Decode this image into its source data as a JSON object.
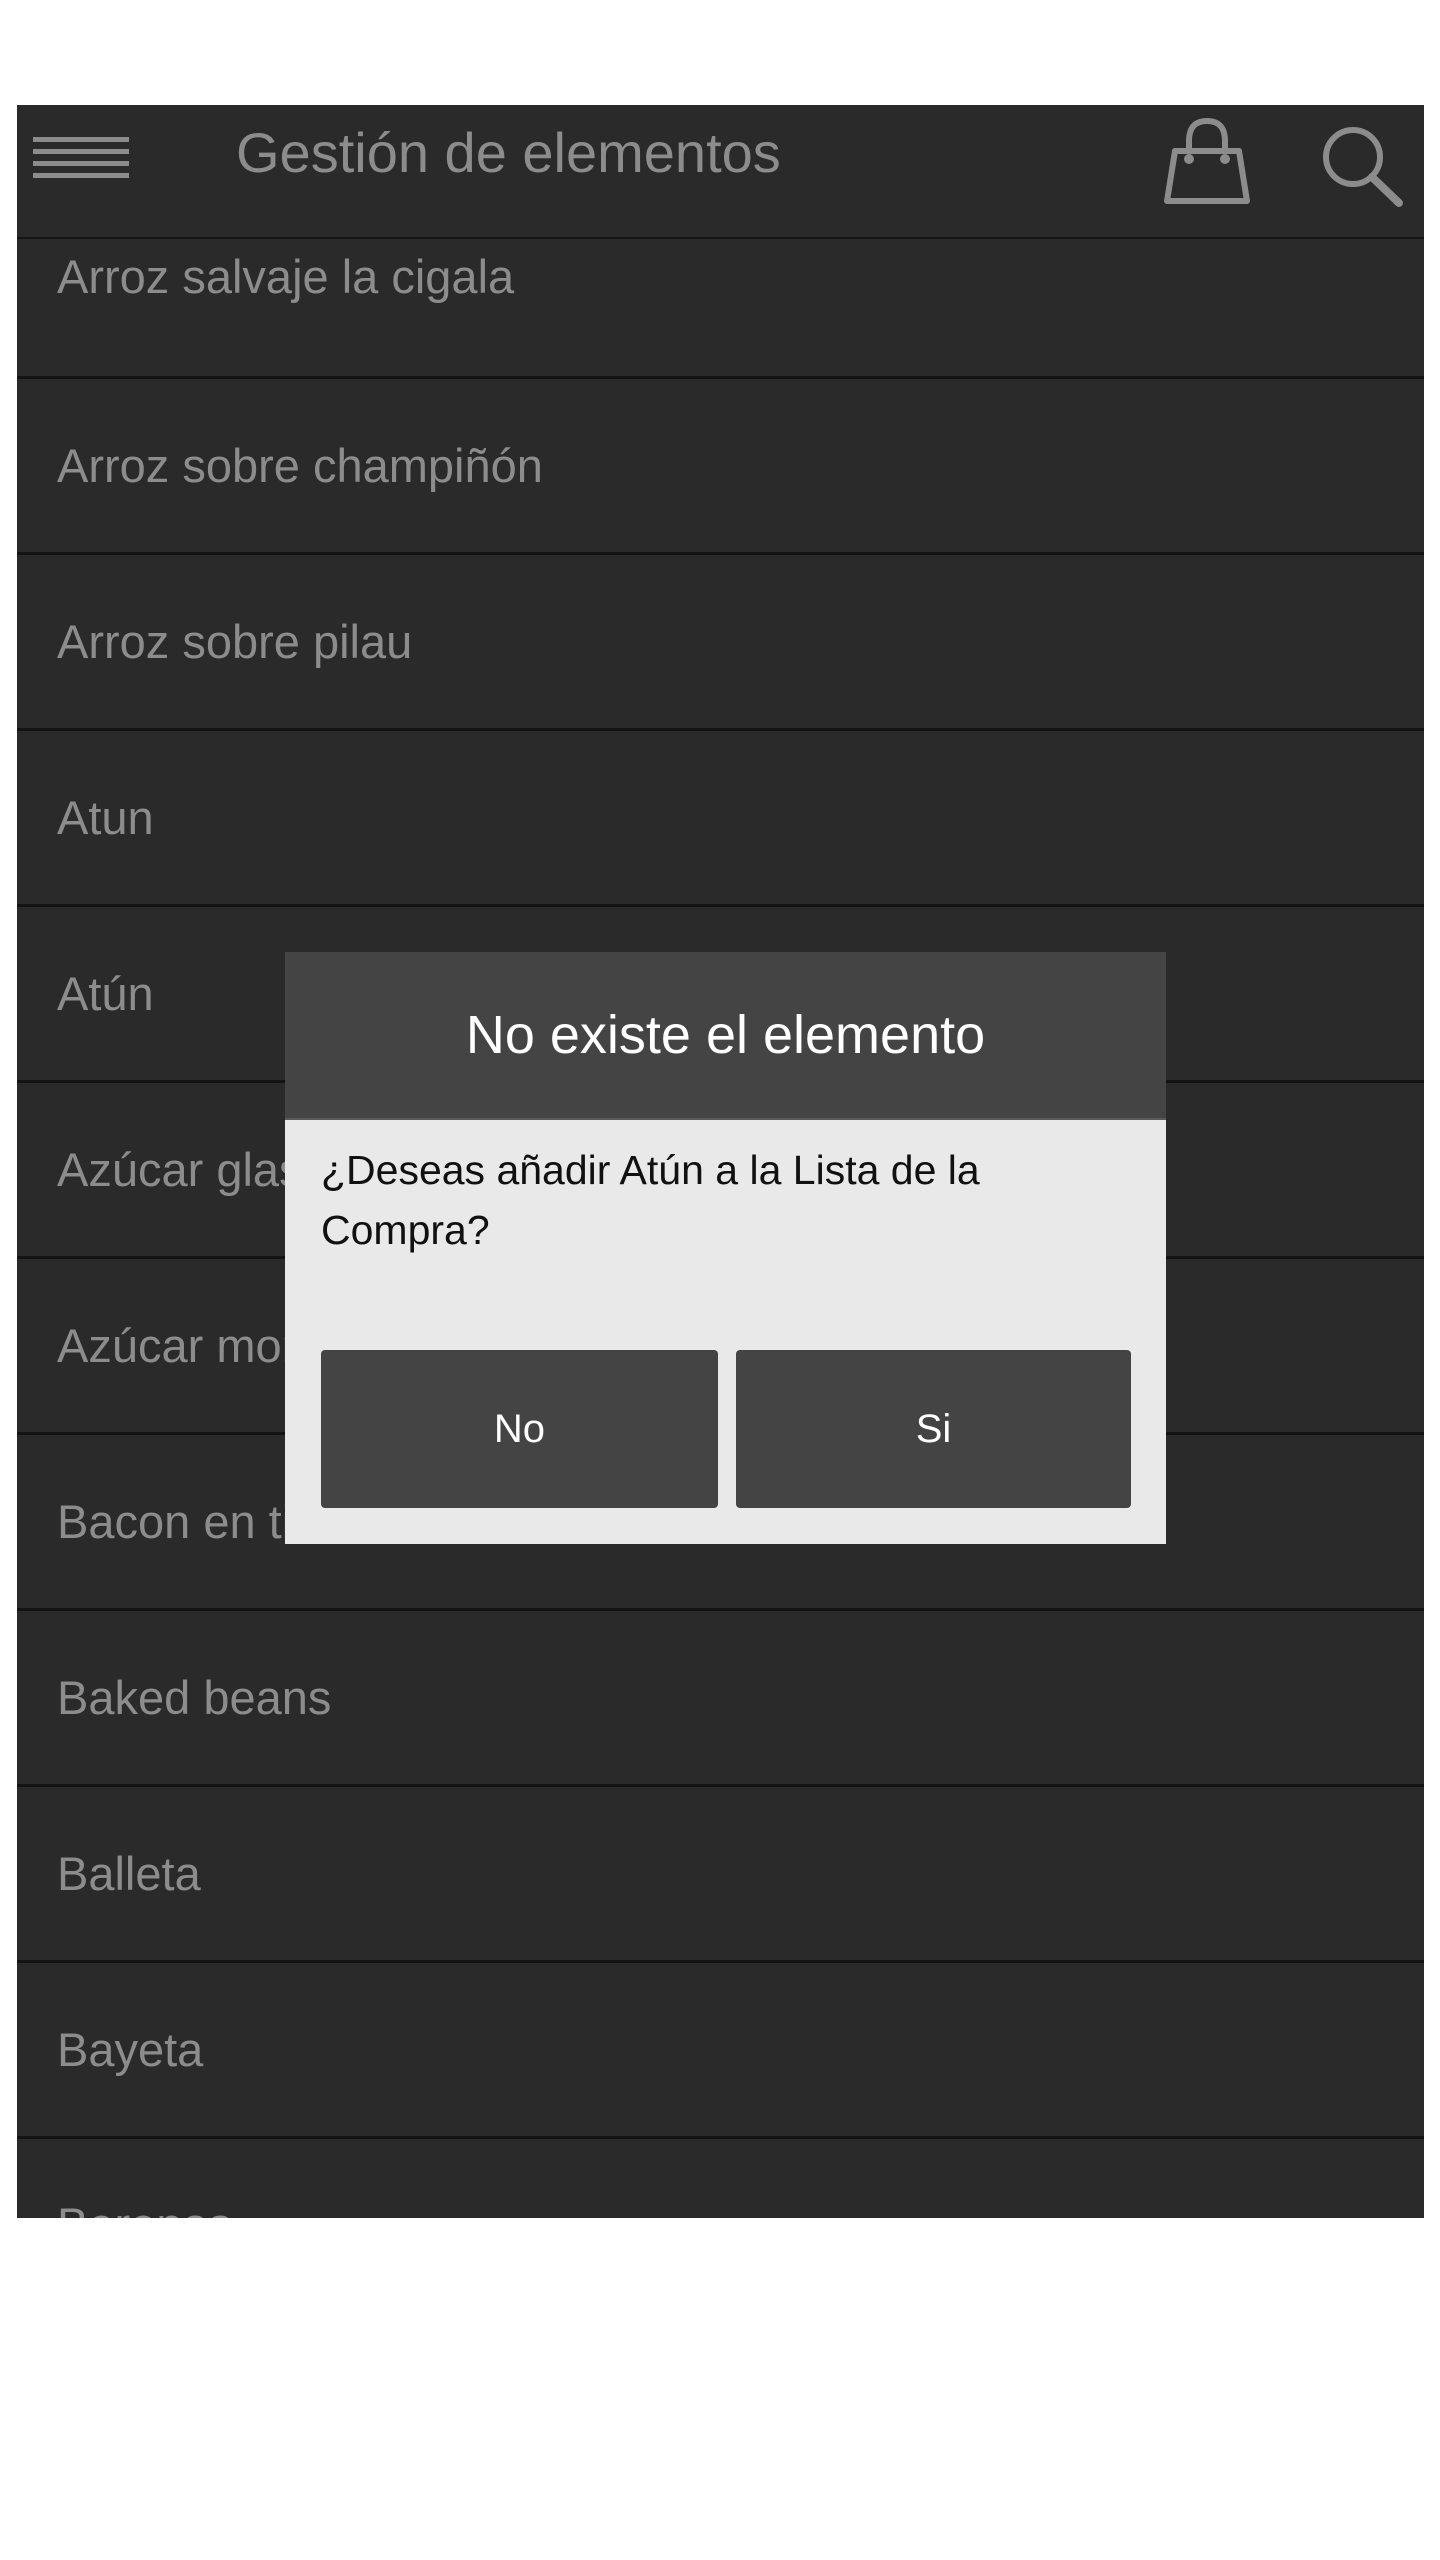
{
  "toolbar": {
    "title": "Gestión de elementos",
    "menu_icon": "hamburger-menu-icon",
    "cart_icon": "shopping-bag-icon",
    "search_icon": "search-icon"
  },
  "items": [
    "Arroz salvaje la cigala",
    "Arroz sobre champiñón",
    "Arroz sobre pilau",
    "Atun",
    "Atún",
    "Azúcar glas",
    "Azúcar moreno",
    "Bacon en tiras",
    "Baked beans",
    "Balleta",
    "Bayeta",
    "Berenas"
  ],
  "dialog": {
    "title": "No existe el elemento",
    "message": "¿Deseas añadir Atún a la Lista de la Compra?",
    "no_label": "No",
    "yes_label": "Si"
  },
  "colors": {
    "background": "#2a2a2a",
    "text_muted": "#8c8c8c",
    "dialog_header": "#444444",
    "dialog_body": "#e9e9e9",
    "divider": "#131313"
  }
}
